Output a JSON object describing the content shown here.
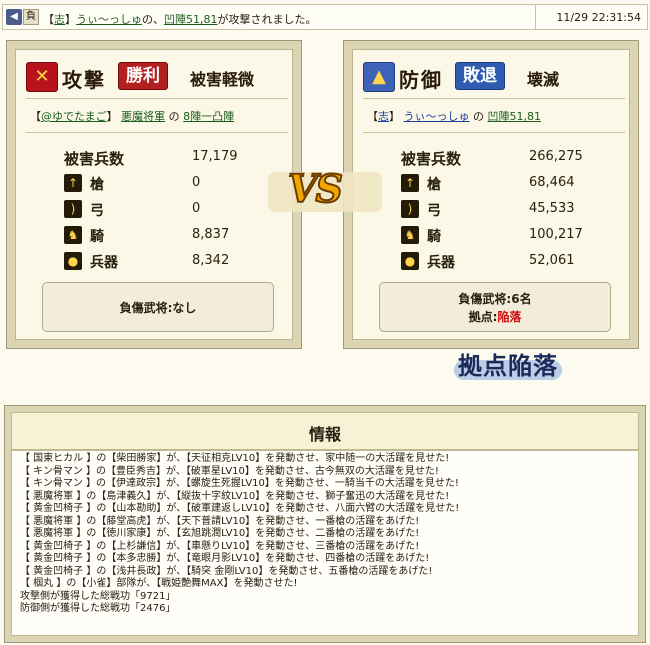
{
  "header": {
    "tag_icon": "◀",
    "result_icon": "負",
    "message_prefix": "【",
    "alliance": "志",
    "message_mid1": "】",
    "player": "うぃ〜っしゅ",
    "message_mid2": "の、",
    "target": "凹陣51,81",
    "message_suffix": "が攻撃されました。",
    "timestamp": "11/29 22:31:54"
  },
  "attacker": {
    "role": "攻撃",
    "badge": "勝利",
    "result": "被害軽微",
    "alliance": "@ゆでたまご",
    "player": "悪魔将軍",
    "particle": "の",
    "location": "8陣一凸陣",
    "stats": {
      "total_label": "被害兵数",
      "total": "17,179",
      "spear_label": "槍",
      "spear": "0",
      "bow_label": "弓",
      "bow": "0",
      "cavalry_label": "騎",
      "cavalry": "8,837",
      "weapon_label": "兵器",
      "weapon": "8,342"
    },
    "wounded": "負傷武将:なし"
  },
  "defender": {
    "role": "防御",
    "badge": "敗退",
    "result": "壊滅",
    "alliance": "志",
    "player": "うぃ〜っしゅ",
    "particle": "の",
    "location": "凹陣51,81",
    "stats": {
      "total_label": "被害兵数",
      "total": "266,275",
      "spear_label": "槍",
      "spear": "68,464",
      "bow_label": "弓",
      "bow": "45,533",
      "cavalry_label": "騎",
      "cavalry": "100,217",
      "weapon_label": "兵器",
      "weapon": "52,061"
    },
    "wounded": "負傷武将:6名",
    "base_label": "拠点:",
    "base_status": "陥落"
  },
  "vs_text": "VS",
  "stamp": "拠点陥落",
  "info": {
    "title": "情報",
    "log": [
      "【 国東ヒカル 】の【柴田勝家】が、【天征相克LV10】を発動させ、家中随一の大活躍を見せた!",
      "【 キン骨マン 】の【豊臣秀吉】が、【破軍星LV10】を発動させ、古今無双の大活躍を見せた!",
      "【 キン骨マン 】の【伊達政宗】が、【螺旋生死握LV10】を発動させ、一騎当千の大活躍を見せた!",
      "【 悪魔将軍 】の【島津義久】が、【縦抜十字紋LV10】を発動させ、獅子奮迅の大活躍を見せた!",
      "【 黄金凹椅子 】の【山本勘助】が、【破軍建返しLV10】を発動させ、八面六臂の大活躍を見せた!",
      "【 悪魔将軍 】の【藤堂高虎】が、【天下普請LV10】を発動させ、一番槍の活躍をあげた!",
      "【 悪魔将軍 】の【徳川家康】が、【玄旭跳潤LV10】を発動させ、二番槍の活躍をあげた!",
      "【 黄金凹椅子 】の【上杉謙信】が、【車懸りLV10】を発動させ、三番槍の活躍をあげた!",
      "【 黄金凹椅子 】の【本多忠勝】が、【竜眼月影LV10】を発動させ、四番槍の活躍をあげた!",
      "【 黄金凹椅子 】の【浅井長政】が、【騎突 金剛LV10】を発動させ、五番槍の活躍をあげた!",
      "【 椢丸 】の【小雀】部隊が、【戦姫艶舞MAX】を発動させた!",
      "攻撃側が獲得した総戦功「9721」",
      "防御側が獲得した総戦功「2476」"
    ]
  }
}
